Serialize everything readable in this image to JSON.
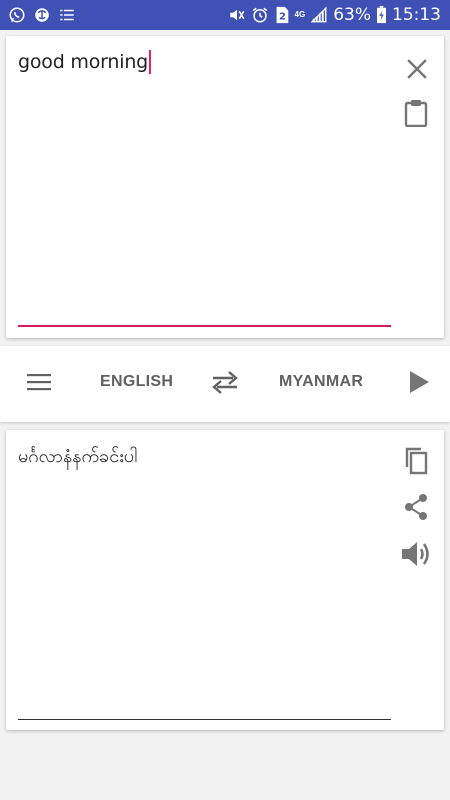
{
  "status_bar": {
    "battery_percent": "63%",
    "time": "15:13",
    "network_type": "4G",
    "sim_badge": "2",
    "icons": [
      "whatsapp-icon",
      "vpn-icon",
      "list-icon",
      "mute-icon",
      "alarm-icon",
      "sim-icon",
      "signal-icon",
      "battery-icon"
    ]
  },
  "input_card": {
    "text": "good morning",
    "accent_color": "#d81b60",
    "icons": [
      "close-icon",
      "clipboard-icon"
    ]
  },
  "language_bar": {
    "source_language": "ENGLISH",
    "target_language": "MYANMAR",
    "icons": [
      "menu-icon",
      "swap-icon",
      "play-icon"
    ]
  },
  "output_card": {
    "text": "မင်္ဂလာနံနက်ခင်းပါ",
    "icons": [
      "copy-icon",
      "share-icon",
      "speaker-icon"
    ]
  },
  "colors": {
    "status_bar": "#3f51b5",
    "background": "#f2f2f2",
    "icon_gray": "#757575",
    "label_gray": "#616161"
  }
}
